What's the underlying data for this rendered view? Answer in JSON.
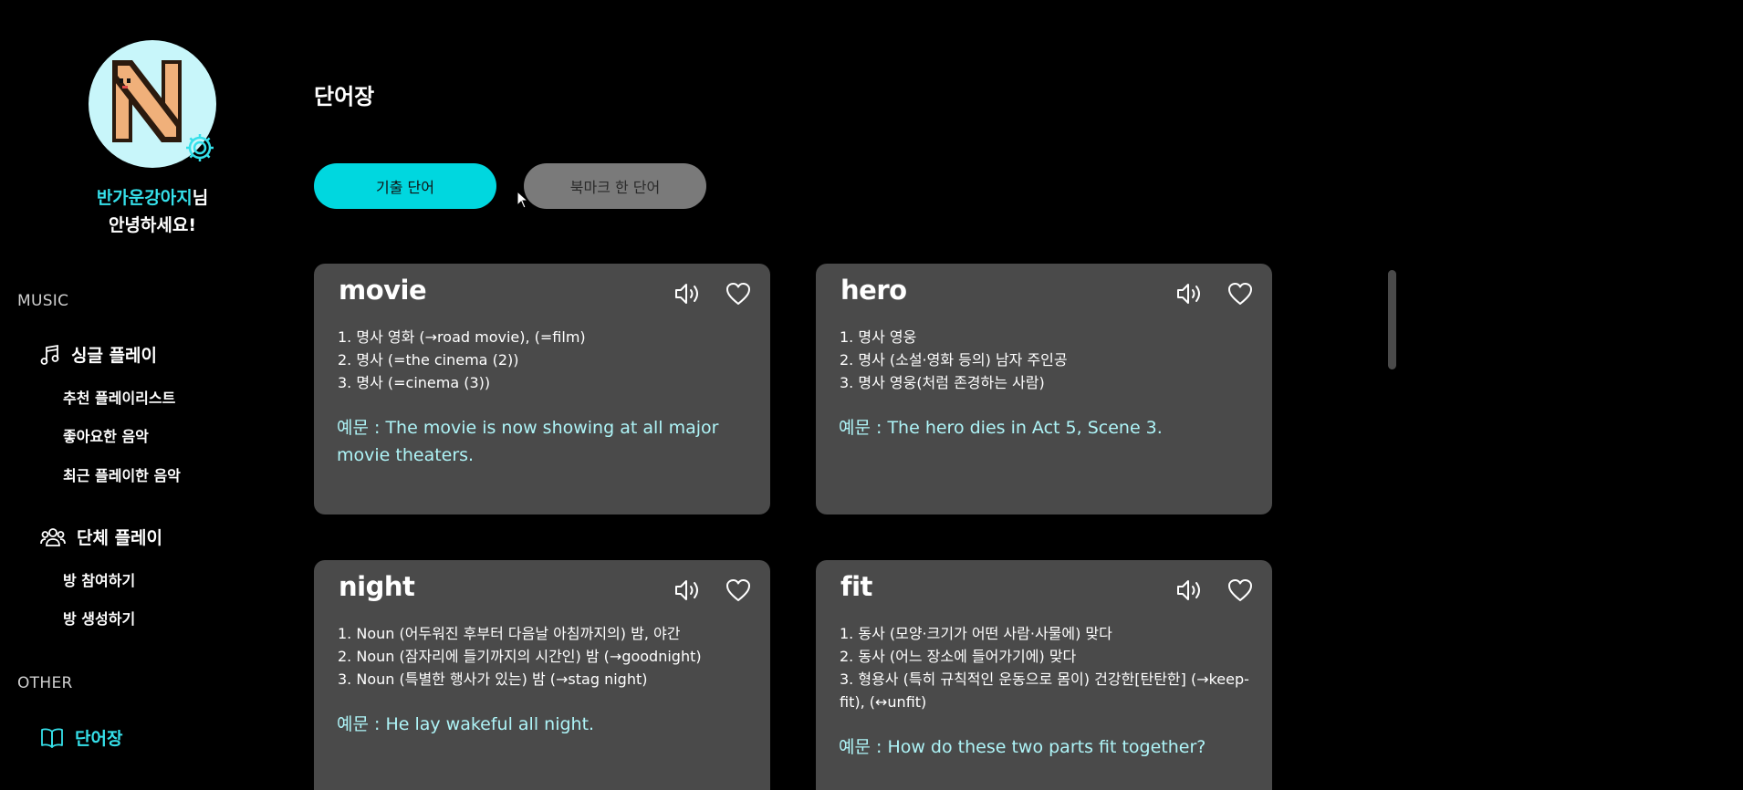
{
  "user": {
    "name": "반가운강아지",
    "suffix": "님",
    "greeting": "안녕하세요!"
  },
  "sidebar": {
    "music_label": "MUSIC",
    "single_play": "싱글 플레이",
    "single_items": [
      "추천 플레이리스트",
      "좋아요한 음악",
      "최근 플레이한 음악"
    ],
    "group_play": "단체 플레이",
    "group_items": [
      "방 참여하기",
      "방 생성하기"
    ],
    "other_label": "OTHER",
    "vocab": "단어장"
  },
  "main": {
    "title": "단어장",
    "tabs": [
      "기출 단어",
      "북마크 한 단어"
    ],
    "active_tab": "기출 단어"
  },
  "cards": [
    {
      "word": "movie",
      "defs": [
        "1. 명사 영화 (→road movie), (=film)",
        "2. 명사 (=the cinema (2))",
        "3. 명사 (=cinema (3))"
      ],
      "example": "예문 : The movie is now showing at all major movie theaters."
    },
    {
      "word": "hero",
      "defs": [
        "1. 명사 영웅",
        "2. 명사 (소설·영화 등의) 남자 주인공",
        "3. 명사 영웅(처럼 존경하는 사람)"
      ],
      "example": "예문 : The hero dies in Act 5, Scene 3."
    },
    {
      "word": "night",
      "defs": [
        "1. Noun (어두워진 후부터 다음날 아침까지의) 밤, 야간",
        "2. Noun (잠자리에 들기까지의 시간인) 밤 (→goodnight)",
        "3. Noun (특별한 행사가 있는) 밤 (→stag night)"
      ],
      "example": "예문 : He lay wakeful all night."
    },
    {
      "word": "fit",
      "defs": [
        "1. 동사 (모양·크기가 어떤 사람·사물에) 맞다",
        "2. 동사 (어느 장소에 들어가기에) 맞다",
        "3. 형용사 (특히 규칙적인 운동으로 몸이) 건강한[탄탄한] (→keep-fit), (↔unfit)"
      ],
      "example": "예문 : How do these two parts fit together?"
    }
  ],
  "colors": {
    "accent": "#35e0ea",
    "tab_active": "#00d7df",
    "tab_inactive": "#7a7a7a",
    "card_bg": "#4a4a4a",
    "example_text": "#aef4f7",
    "avatar_bg": "#c8f6fa"
  },
  "icons": {
    "avatar_logo": "pixel-letter-n-icon",
    "avatar_settings": "gear-icon",
    "single_play": "music-note-icon",
    "group_play": "people-icon",
    "vocab": "open-book-icon",
    "card_audio": "speaker-icon",
    "card_bookmark": "heart-icon"
  }
}
